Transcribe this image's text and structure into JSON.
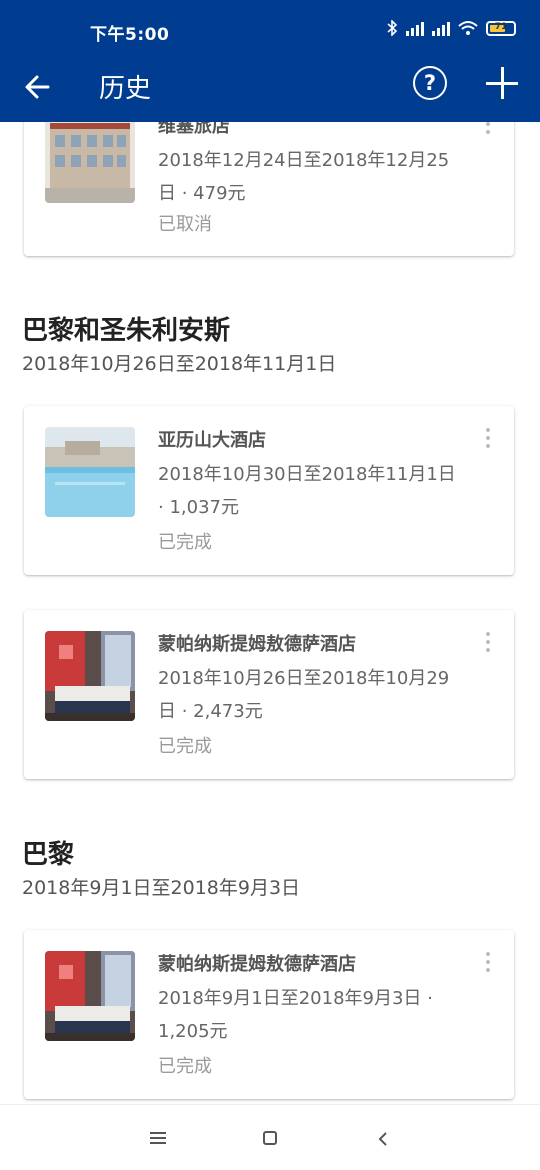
{
  "status_bar": {
    "time": "下午5:00",
    "battery_level": "71"
  },
  "app_bar": {
    "title": "历史",
    "back_icon": "arrow-left-icon",
    "help_label": "?",
    "add_icon": "plus-icon"
  },
  "colors": {
    "primary": "#003c8f",
    "status_muted": "#9a9a9a"
  },
  "trips": [
    {
      "title": "",
      "dates": "",
      "bookings": [
        {
          "name": "维塞旅店",
          "dates_price": "2018年12月24日至2018年12月25日 · 479元",
          "status": "已取消",
          "image": "hotel-building"
        }
      ]
    },
    {
      "title": "巴黎和圣朱利安斯",
      "dates": "2018年10月26日至2018年11月1日",
      "bookings": [
        {
          "name": "亚历山大酒店",
          "dates_price": "2018年10月30日至2018年11月1日 · 1,037元",
          "status": "已完成",
          "image": "rooftop-pool"
        },
        {
          "name": "蒙帕纳斯提姆敖德萨酒店",
          "dates_price": "2018年10月26日至2018年10月29日 · 2,473元",
          "status": "已完成",
          "image": "hotel-room"
        }
      ]
    },
    {
      "title": "巴黎",
      "dates": "2018年9月1日至2018年9月3日",
      "bookings": [
        {
          "name": "蒙帕纳斯提姆敖德萨酒店",
          "dates_price": "2018年9月1日至2018年9月3日 · 1,205元",
          "status": "已完成",
          "image": "hotel-room"
        }
      ]
    }
  ],
  "nav_bar": {
    "menu_icon": "menu-icon",
    "home_icon": "home-icon",
    "back_icon": "back-chevron-icon"
  }
}
